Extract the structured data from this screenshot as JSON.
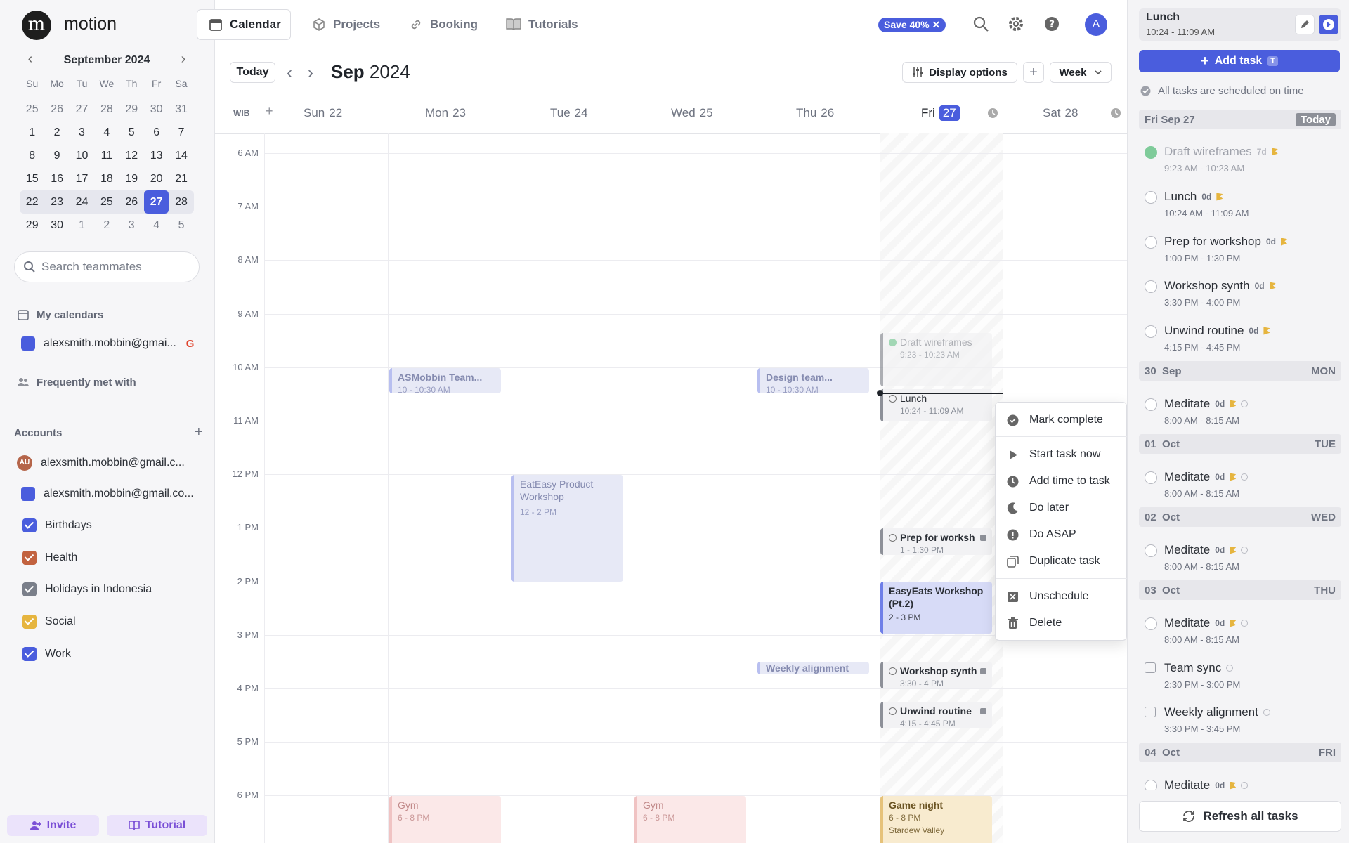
{
  "app": {
    "name": "motion",
    "logo_letter": "m"
  },
  "nav": {
    "tabs": [
      {
        "label": "Calendar"
      },
      {
        "label": "Projects"
      },
      {
        "label": "Booking"
      },
      {
        "label": "Tutorials"
      }
    ],
    "save_badge": "Save 40%",
    "user_initial": "A"
  },
  "mini_calendar": {
    "title": "September 2024",
    "dow": [
      "Su",
      "Mo",
      "Tu",
      "We",
      "Th",
      "Fr",
      "Sa"
    ],
    "weeks": [
      [
        "25",
        "26",
        "27",
        "28",
        "29",
        "30",
        "31"
      ],
      [
        "1",
        "2",
        "3",
        "4",
        "5",
        "6",
        "7"
      ],
      [
        "8",
        "9",
        "10",
        "11",
        "12",
        "13",
        "14"
      ],
      [
        "15",
        "16",
        "17",
        "18",
        "19",
        "20",
        "21"
      ],
      [
        "22",
        "23",
        "24",
        "25",
        "26",
        "27",
        "28"
      ],
      [
        "29",
        "30",
        "1",
        "2",
        "3",
        "4",
        "5"
      ]
    ],
    "today": "27"
  },
  "sidebar": {
    "search_placeholder": "Search teammates",
    "my_calendars": "My calendars",
    "my_calendar_account": "alexsmith.mobbin@gmai...",
    "frequently_met": "Frequently met with",
    "accounts_title": "Accounts",
    "accounts": [
      {
        "label": "alexsmith.mobbin@gmail.c...",
        "avatar": "AU"
      },
      {
        "label": "alexsmith.mobbin@gmail.co..."
      }
    ],
    "calendars": [
      {
        "label": "Birthdays",
        "color": "#4a5ddd"
      },
      {
        "label": "Health",
        "color": "#c2623f"
      },
      {
        "label": "Holidays in Indonesia",
        "color": "#7a7f8a"
      },
      {
        "label": "Social",
        "color": "#e6b53f"
      },
      {
        "label": "Work",
        "color": "#4a5ddd"
      }
    ],
    "invite_label": "Invite",
    "tutorial_label": "Tutorial"
  },
  "calendar": {
    "today_label": "Today",
    "month_bold": "Sep",
    "year": "2024",
    "display_options": "Display options",
    "view": "Week",
    "timezone": "WIB",
    "days": [
      {
        "name": "Sun",
        "num": "22"
      },
      {
        "name": "Mon",
        "num": "23"
      },
      {
        "name": "Tue",
        "num": "24"
      },
      {
        "name": "Wed",
        "num": "25"
      },
      {
        "name": "Thu",
        "num": "26"
      },
      {
        "name": "Fri",
        "num": "27"
      },
      {
        "name": "Sat",
        "num": "28"
      }
    ],
    "hours": [
      "6 AM",
      "7 AM",
      "8 AM",
      "9 AM",
      "10 AM",
      "11 AM",
      "12 PM",
      "1 PM",
      "2 PM",
      "3 PM",
      "4 PM",
      "5 PM",
      "6 PM"
    ],
    "events": [
      {
        "title": "ASMobbin Team...",
        "time": "10 - 10:30 AM"
      },
      {
        "title": "Design team...",
        "time": "10 - 10:30 AM"
      },
      {
        "title": "EatEasy Product Workshop",
        "time": "12 - 2 PM"
      },
      {
        "title": "Weekly alignment"
      },
      {
        "title": "Gym",
        "time": "6 - 8 PM"
      },
      {
        "title": "Gym",
        "time": "6 - 8 PM"
      },
      {
        "title": "Draft wireframes",
        "time": "9:23 - 10:23 AM"
      },
      {
        "title": "Lunch",
        "time": "10:24 - 11:09 AM"
      },
      {
        "title": "Prep for worksh",
        "time": "1 - 1:30 PM"
      },
      {
        "title": "EasyEats Workshop (Pt.2)",
        "time": "2 - 3 PM"
      },
      {
        "title": "Workshop synth",
        "time": "3:30 - 4 PM"
      },
      {
        "title": "Unwind routine",
        "time": "4:15 - 4:45 PM"
      },
      {
        "title": "Game night",
        "time": "6 - 8 PM",
        "location": "Stardew Valley"
      }
    ]
  },
  "context_menu": {
    "items": [
      {
        "label": "Mark complete"
      },
      {
        "label": "Start task now"
      },
      {
        "label": "Add time to task"
      },
      {
        "label": "Do later"
      },
      {
        "label": "Do ASAP"
      },
      {
        "label": "Duplicate task"
      },
      {
        "label": "Unschedule"
      },
      {
        "label": "Delete"
      }
    ]
  },
  "right_panel": {
    "current": {
      "title": "Lunch",
      "time": "10:24 - 11:09 AM"
    },
    "add_task": "Add task",
    "add_task_key": "T",
    "status": "All tasks are scheduled on time",
    "today_section": {
      "date": "Fri Sep 27",
      "badge": "Today"
    },
    "today_tasks": [
      {
        "name": "Draft wireframes",
        "dur": "7d",
        "time": "9:23 AM - 10:23 AM"
      },
      {
        "name": "Lunch",
        "dur": "0d",
        "time": "10:24 AM - 11:09 AM"
      },
      {
        "name": "Prep for workshop",
        "dur": "0d",
        "time": "1:00 PM - 1:30 PM"
      },
      {
        "name": "Workshop synth",
        "dur": "0d",
        "time": "3:30 PM - 4:00 PM"
      },
      {
        "name": "Unwind routine",
        "dur": "0d",
        "time": "4:15 PM - 4:45 PM"
      }
    ],
    "sections": [
      {
        "date": "30  Sep",
        "dow": "MON",
        "name": "Meditate",
        "dur": "0d",
        "time": "8:00 AM - 8:15 AM"
      },
      {
        "date": "01  Oct",
        "dow": "TUE",
        "name": "Meditate",
        "dur": "0d",
        "time": "8:00 AM - 8:15 AM"
      },
      {
        "date": "02  Oct",
        "dow": "WED",
        "name": "Meditate",
        "dur": "0d",
        "time": "8:00 AM - 8:15 AM"
      },
      {
        "date": "03  Oct",
        "dow": "THU",
        "name": "Meditate",
        "dur": "0d",
        "time": "8:00 AM - 8:15 AM"
      }
    ],
    "team_sync": {
      "name": "Team sync",
      "time": "2:30 PM - 3:00 PM"
    },
    "weekly": {
      "name": "Weekly alignment",
      "time": "3:30 PM - 3:45 PM"
    },
    "oct04": {
      "date": "04  Oct",
      "dow": "FRI",
      "name": "Meditate",
      "dur": "0d"
    },
    "refresh": "Refresh all tasks"
  }
}
